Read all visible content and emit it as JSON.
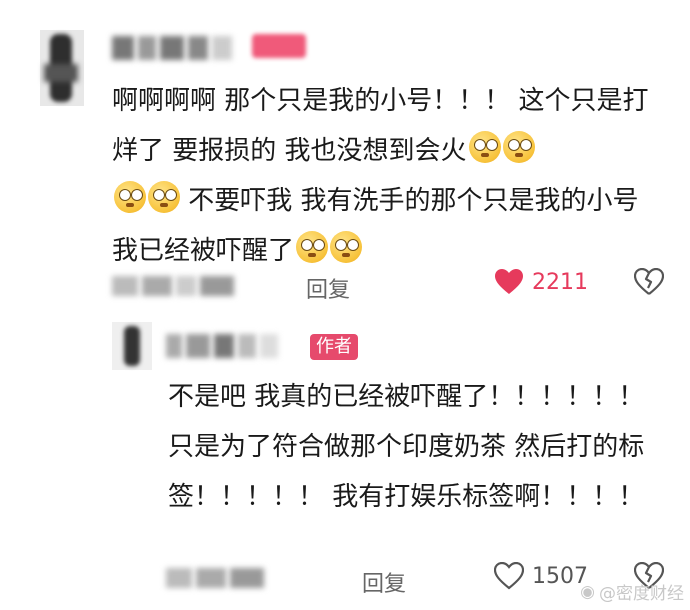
{
  "comment1": {
    "text_part1": "啊啊啊啊 那个只是我的小号！！！ 这个只是打烊了 要报损的 我也没想到会火",
    "text_part2": " 不要吓我 我有洗手的那个只是我的小号 我已经被吓醒了",
    "reply_label": "回复",
    "likes": "2211",
    "liked": true
  },
  "comment2": {
    "author_badge": "作者",
    "text": "不是吧 我真的已经被吓醒了！！！！！！ 只是为了符合做那个印度奶茶 然后打的标签！！！！！ 我有打娱乐标签啊！！！！",
    "reply_label": "回复",
    "likes": "1507",
    "liked": false
  },
  "watermark": "@密度财经",
  "colors": {
    "like_active": "#e63a5c",
    "author_badge": "#e64a6c",
    "secondary_text": "#666666"
  },
  "icons": [
    "heart-icon",
    "broken-heart-icon",
    "weibo-icon",
    "emoji-flushed-icon"
  ]
}
